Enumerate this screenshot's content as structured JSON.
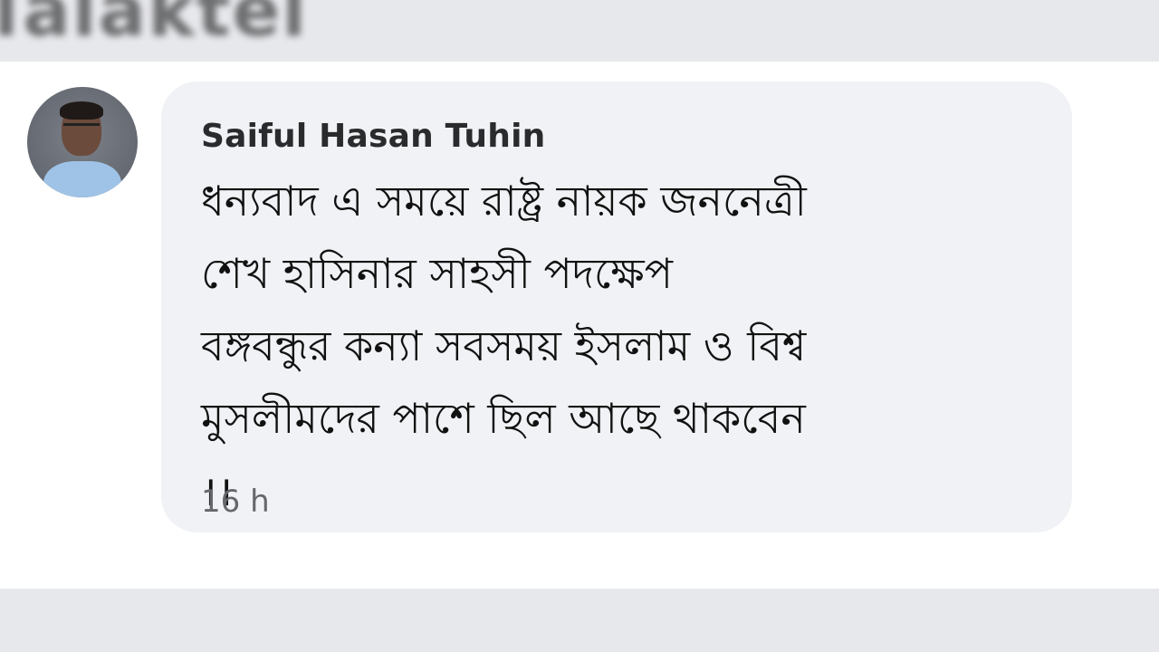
{
  "background_header": {
    "title": "Talaktel"
  },
  "comment": {
    "author": "Saiful Hasan Tuhin",
    "message": "ধন্যবাদ এ সময়ে রাষ্ট্র নায়ক জননেত্রী\nশেখ হাসিনার সাহসী পদক্ষেপ\nবঙ্গবন্ধুর কন্যা সবসময় ইসলাম ও বিশ্ব\nমুসলীমদের পাশে ছিল আছে থাকবেন\n।।",
    "timestamp": "16 h"
  },
  "colors": {
    "bubble_background": "#f0f2f5",
    "page_background": "#ffffff",
    "strip_background": "#e7e8eb",
    "timestamp_text": "#65676b"
  }
}
